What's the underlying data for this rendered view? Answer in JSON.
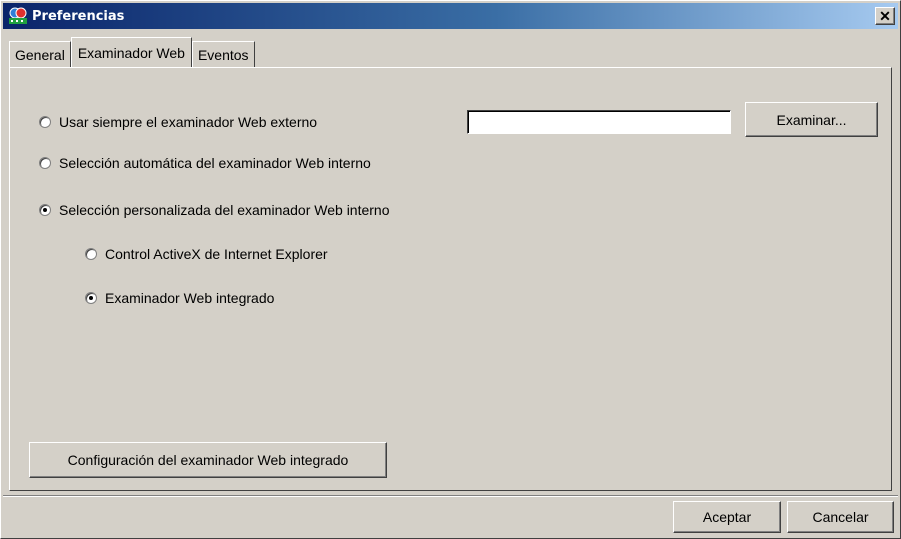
{
  "window": {
    "title": "Preferencias",
    "close_glyph": "✕",
    "titlebar_gradient": [
      "#0a246a",
      "#a6caf0"
    ],
    "background": "#d4d0c8"
  },
  "tabs": [
    {
      "label": "General",
      "active": false
    },
    {
      "label": "Examinador Web",
      "active": true
    },
    {
      "label": "Eventos",
      "active": false
    }
  ],
  "browser": {
    "options": [
      {
        "label": "Usar siempre el examinador Web externo",
        "checked": false
      },
      {
        "label": "Selección automática del examinador Web interno",
        "checked": false
      },
      {
        "label": "Selección personalizada del examinador Web interno",
        "checked": true
      }
    ],
    "sub_options": [
      {
        "label": "Control ActiveX de Internet Explorer",
        "checked": false
      },
      {
        "label": "Examinador Web integrado",
        "checked": true
      }
    ],
    "external_path_value": "",
    "browse_label": "Examinar...",
    "config_label": "Configuración del examinador Web integrado"
  },
  "footer": {
    "ok_label": "Aceptar",
    "cancel_label": "Cancelar"
  }
}
